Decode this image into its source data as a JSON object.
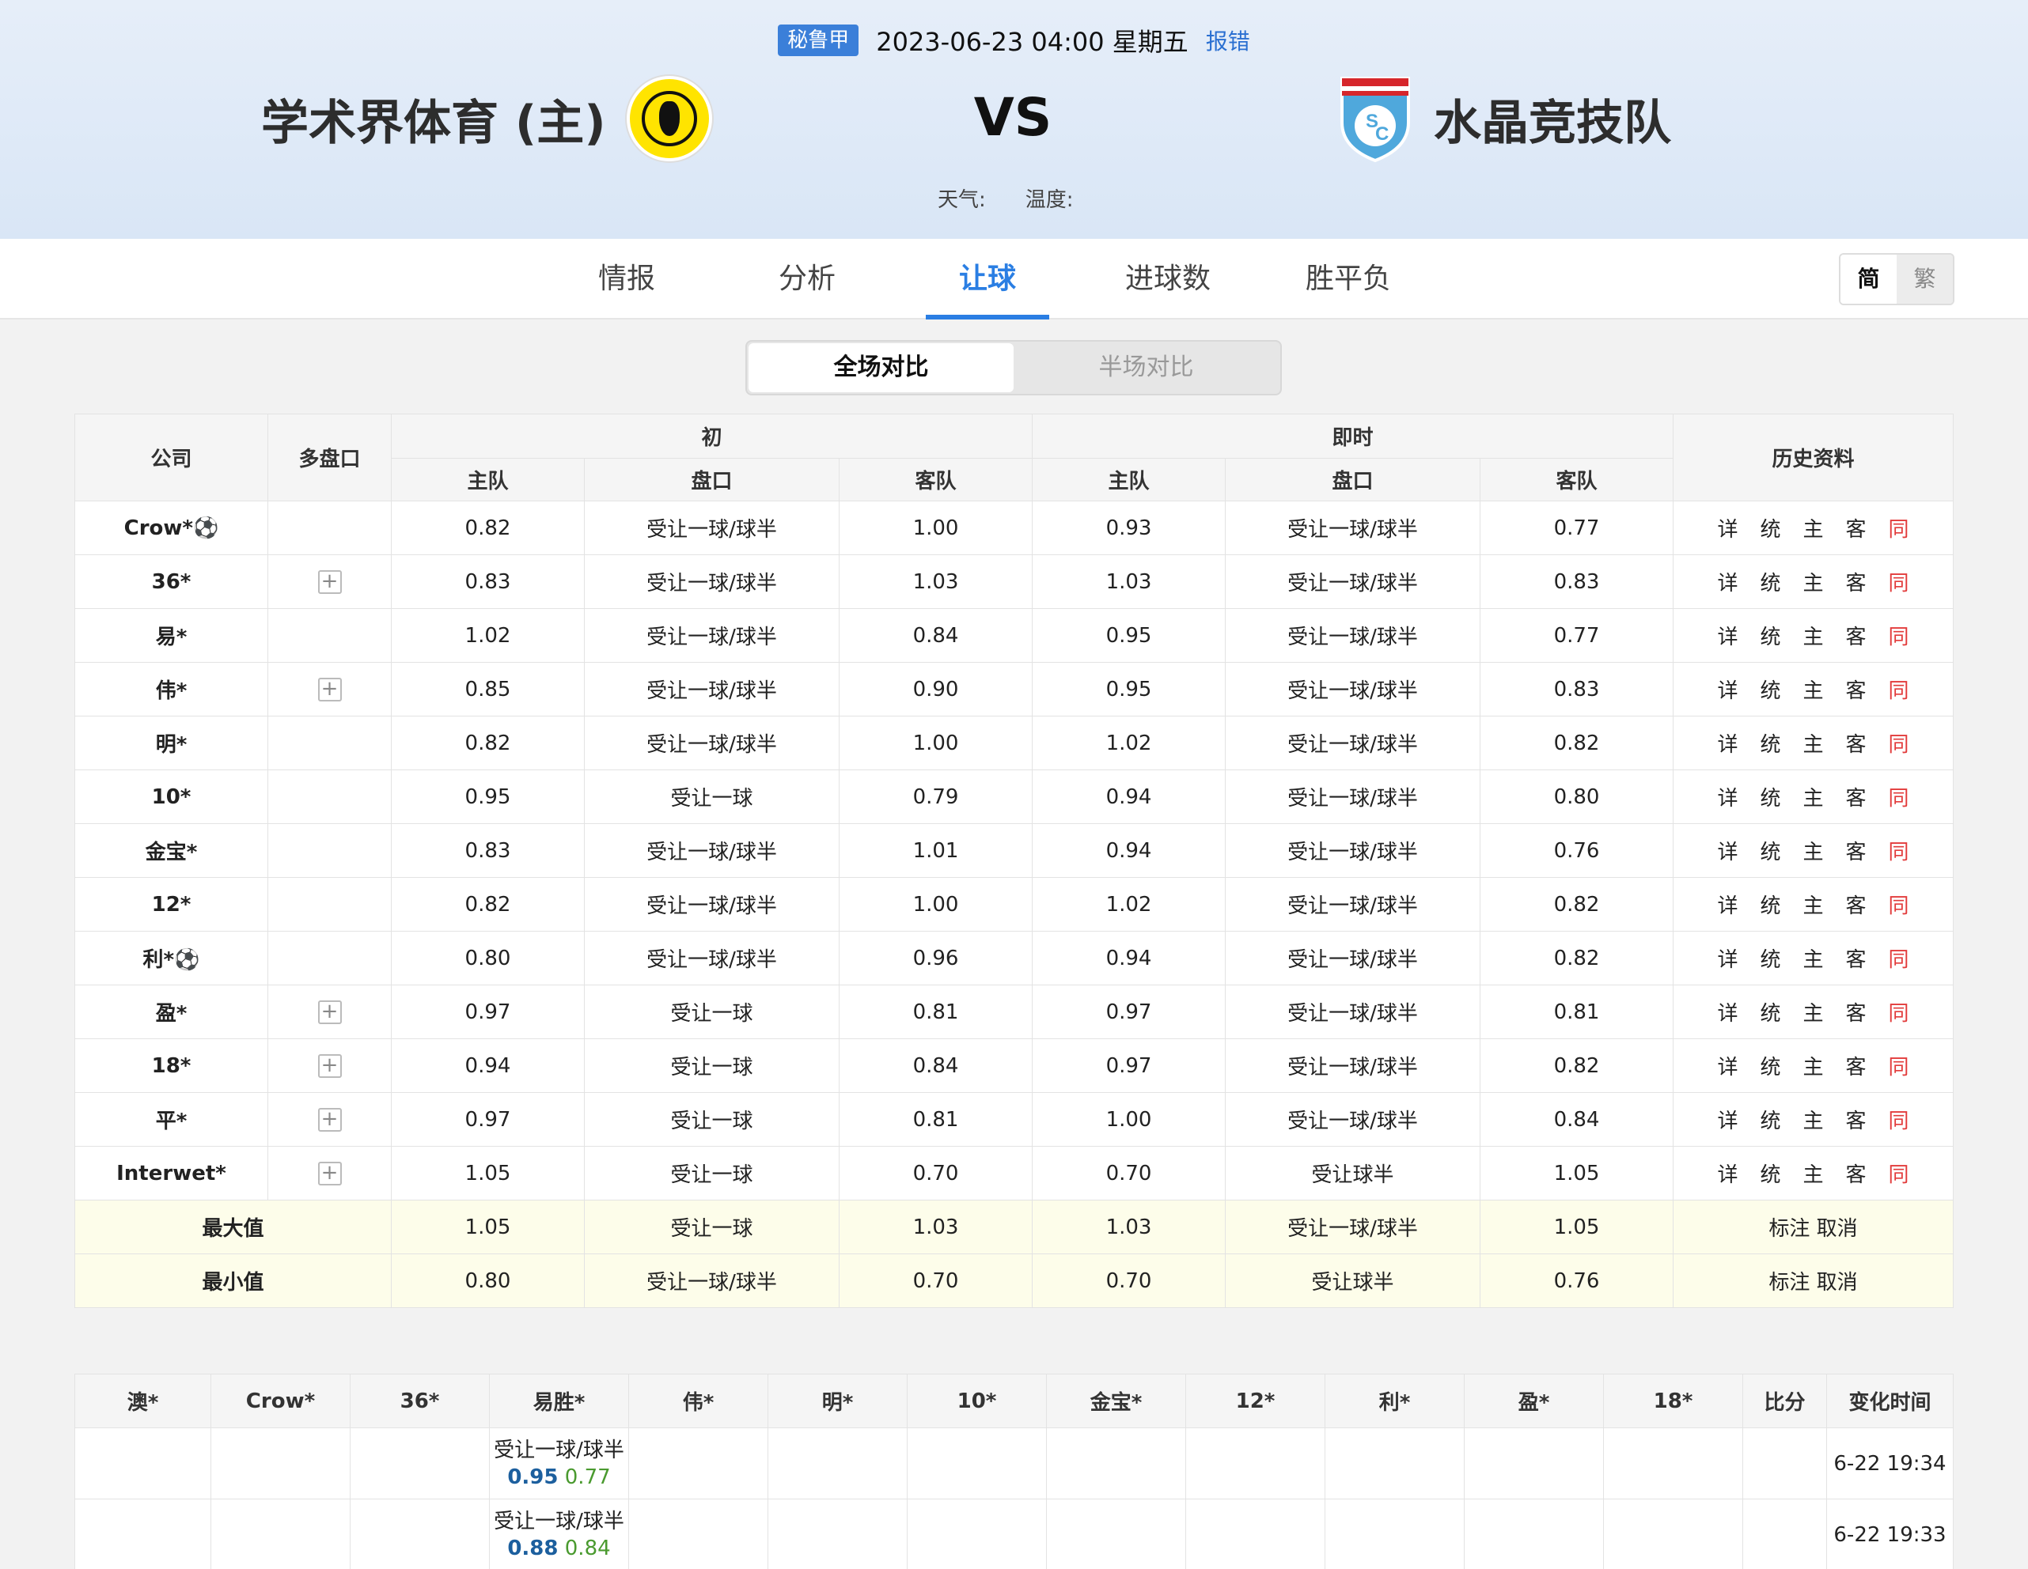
{
  "match": {
    "league": "秘鲁甲",
    "datetime": "2023-06-23 04:00 星期五",
    "report": "报错",
    "home_team": "学术界体育 (主)",
    "away_team": "水晶竞技队",
    "vs": "VS",
    "weather_label": "天气:",
    "temperature_label": "温度:"
  },
  "tabs": [
    "情报",
    "分析",
    "让球",
    "进球数",
    "胜平负"
  ],
  "active_tab": "让球",
  "lang": {
    "simplified": "简",
    "traditional": "繁"
  },
  "segment": {
    "full": "全场对比",
    "half": "半场对比"
  },
  "odds_headers": {
    "company": "公司",
    "multi": "多盘口",
    "initial": "初",
    "live": "即时",
    "history": "历史资料",
    "home": "主队",
    "line": "盘口",
    "away": "客队"
  },
  "history_links": [
    "详",
    "统",
    "主",
    "客",
    "同"
  ],
  "odds_rows": [
    {
      "company": "Crow*⚽",
      "multi": false,
      "ih": "0.82",
      "il": "受让一球/球半",
      "ia": "1.00",
      "lh": "0.93",
      "ll": "受让一球/球半",
      "la": "0.77"
    },
    {
      "company": "36*",
      "multi": true,
      "ih": "0.83",
      "il": "受让一球/球半",
      "ia": "1.03",
      "lh": "1.03",
      "ll": "受让一球/球半",
      "la": "0.83"
    },
    {
      "company": "易*",
      "multi": false,
      "ih": "1.02",
      "il": "受让一球/球半",
      "ia": "0.84",
      "lh": "0.95",
      "ll": "受让一球/球半",
      "la": "0.77"
    },
    {
      "company": "伟*",
      "multi": true,
      "ih": "0.85",
      "il": "受让一球/球半",
      "ia": "0.90",
      "lh": "0.95",
      "ll": "受让一球/球半",
      "la": "0.83"
    },
    {
      "company": "明*",
      "multi": false,
      "ih": "0.82",
      "il": "受让一球/球半",
      "ia": "1.00",
      "lh": "1.02",
      "ll": "受让一球/球半",
      "la": "0.82"
    },
    {
      "company": "10*",
      "multi": false,
      "ih": "0.95",
      "il": "受让一球",
      "ia": "0.79",
      "lh": "0.94",
      "ll": "受让一球/球半",
      "la": "0.80"
    },
    {
      "company": "金宝*",
      "multi": false,
      "ih": "0.83",
      "il": "受让一球/球半",
      "ia": "1.01",
      "lh": "0.94",
      "ll": "受让一球/球半",
      "la": "0.76"
    },
    {
      "company": "12*",
      "multi": false,
      "ih": "0.82",
      "il": "受让一球/球半",
      "ia": "1.00",
      "lh": "1.02",
      "ll": "受让一球/球半",
      "la": "0.82"
    },
    {
      "company": "利*⚽",
      "multi": false,
      "ih": "0.80",
      "il": "受让一球/球半",
      "ia": "0.96",
      "lh": "0.94",
      "ll": "受让一球/球半",
      "la": "0.82"
    },
    {
      "company": "盈*",
      "multi": true,
      "ih": "0.97",
      "il": "受让一球",
      "ia": "0.81",
      "lh": "0.97",
      "ll": "受让一球/球半",
      "la": "0.81"
    },
    {
      "company": "18*",
      "multi": true,
      "ih": "0.94",
      "il": "受让一球",
      "ia": "0.84",
      "lh": "0.97",
      "ll": "受让一球/球半",
      "la": "0.82"
    },
    {
      "company": "平*",
      "multi": true,
      "ih": "0.97",
      "il": "受让一球",
      "ia": "0.81",
      "lh": "1.00",
      "ll": "受让一球/球半",
      "la": "0.84"
    },
    {
      "company": "Interwet*",
      "multi": true,
      "ih": "1.05",
      "il": "受让一球",
      "ia": "0.70",
      "lh": "0.70",
      "ll": "受让球半",
      "la": "1.05"
    }
  ],
  "stats": [
    {
      "label": "最大值",
      "ih": "1.05",
      "il": "受让一球",
      "ia": "1.03",
      "lh": "1.03",
      "ll": "受让一球/球半",
      "la": "1.05",
      "action": "标注 取消"
    },
    {
      "label": "最小值",
      "ih": "0.80",
      "il": "受让一球/球半",
      "ia": "0.70",
      "lh": "0.70",
      "ll": "受让球半",
      "la": "0.76",
      "action": "标注 取消"
    }
  ],
  "change_headers": [
    "澳*",
    "Crow*",
    "36*",
    "易胜*",
    "伟*",
    "明*",
    "10*",
    "金宝*",
    "12*",
    "利*",
    "盈*",
    "18*",
    "比分",
    "变化时间"
  ],
  "change_rows": [
    {
      "col": 3,
      "line": "受让一球/球半",
      "home": "0.95",
      "away": "0.77",
      "time": "6-22 19:34"
    },
    {
      "col": 3,
      "line": "受让一球/球半",
      "home": "0.88",
      "away": "0.84",
      "time": "6-22 19:33"
    }
  ]
}
